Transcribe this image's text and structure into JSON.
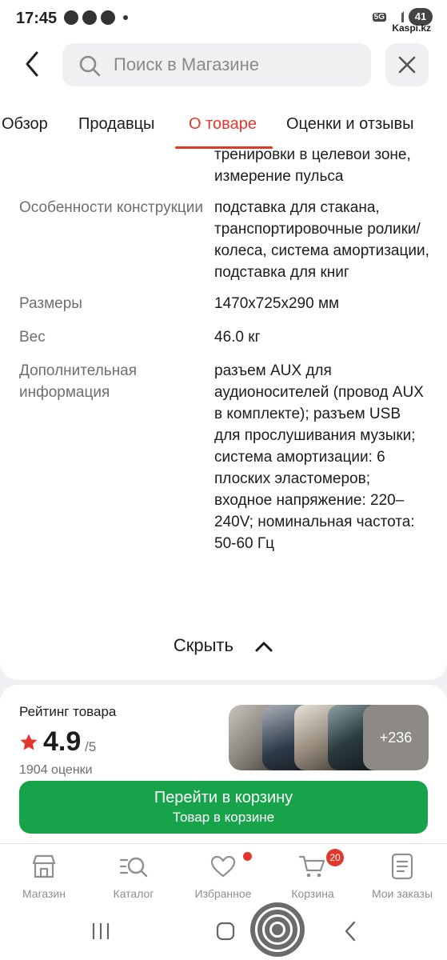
{
  "status_bar": {
    "time": "17:45",
    "network": "5G",
    "battery": "41",
    "watermark": "Kaspi.kz"
  },
  "search": {
    "placeholder": "Поиск в Магазине"
  },
  "tabs": [
    {
      "label": "Обзор",
      "active": false
    },
    {
      "label": "Продавцы",
      "active": false
    },
    {
      "label": "О товаре",
      "active": true
    },
    {
      "label": "Оценки и отзывы",
      "active": false
    }
  ],
  "specs": {
    "partial_value": "тренировки в целевой зоне, измерение пульса",
    "rows": [
      {
        "key": "Особенности конструкции",
        "value": "подставка для стакана, транспортировочные ролики/колеса, система амортизации, подставка для книг"
      },
      {
        "key": "Размеры",
        "value": "1470x725x290 мм"
      },
      {
        "key": "Вес",
        "value": "46.0 кг"
      },
      {
        "key": "Дополнительная информация",
        "value": "разъем AUX для аудионосителей (провод AUX в комплекте); разъем USB для прослушивания музыки; система амортизации: 6 плоских эластомеров; входное напряжение: 220–240V; номинальная частота: 50-60 Гц"
      }
    ],
    "hide_label": "Скрыть"
  },
  "rating": {
    "title": "Рейтинг товара",
    "value": "4.9",
    "max": "/5",
    "count": "1904 оценки",
    "more_photos": "+236"
  },
  "cart_button": {
    "line1": "Перейти в корзину",
    "line2": "Товар в корзине"
  },
  "nav": {
    "items": [
      {
        "label": "Магазин",
        "icon": "store-icon"
      },
      {
        "label": "Каталог",
        "icon": "catalog-search-icon"
      },
      {
        "label": "Избранное",
        "icon": "heart-icon"
      },
      {
        "label": "Корзина",
        "icon": "cart-icon"
      },
      {
        "label": "Мои заказы",
        "icon": "orders-icon"
      }
    ],
    "cart_badge": "20"
  },
  "colors": {
    "accent_red": "#e3362c",
    "cart_green": "#17a34a"
  }
}
